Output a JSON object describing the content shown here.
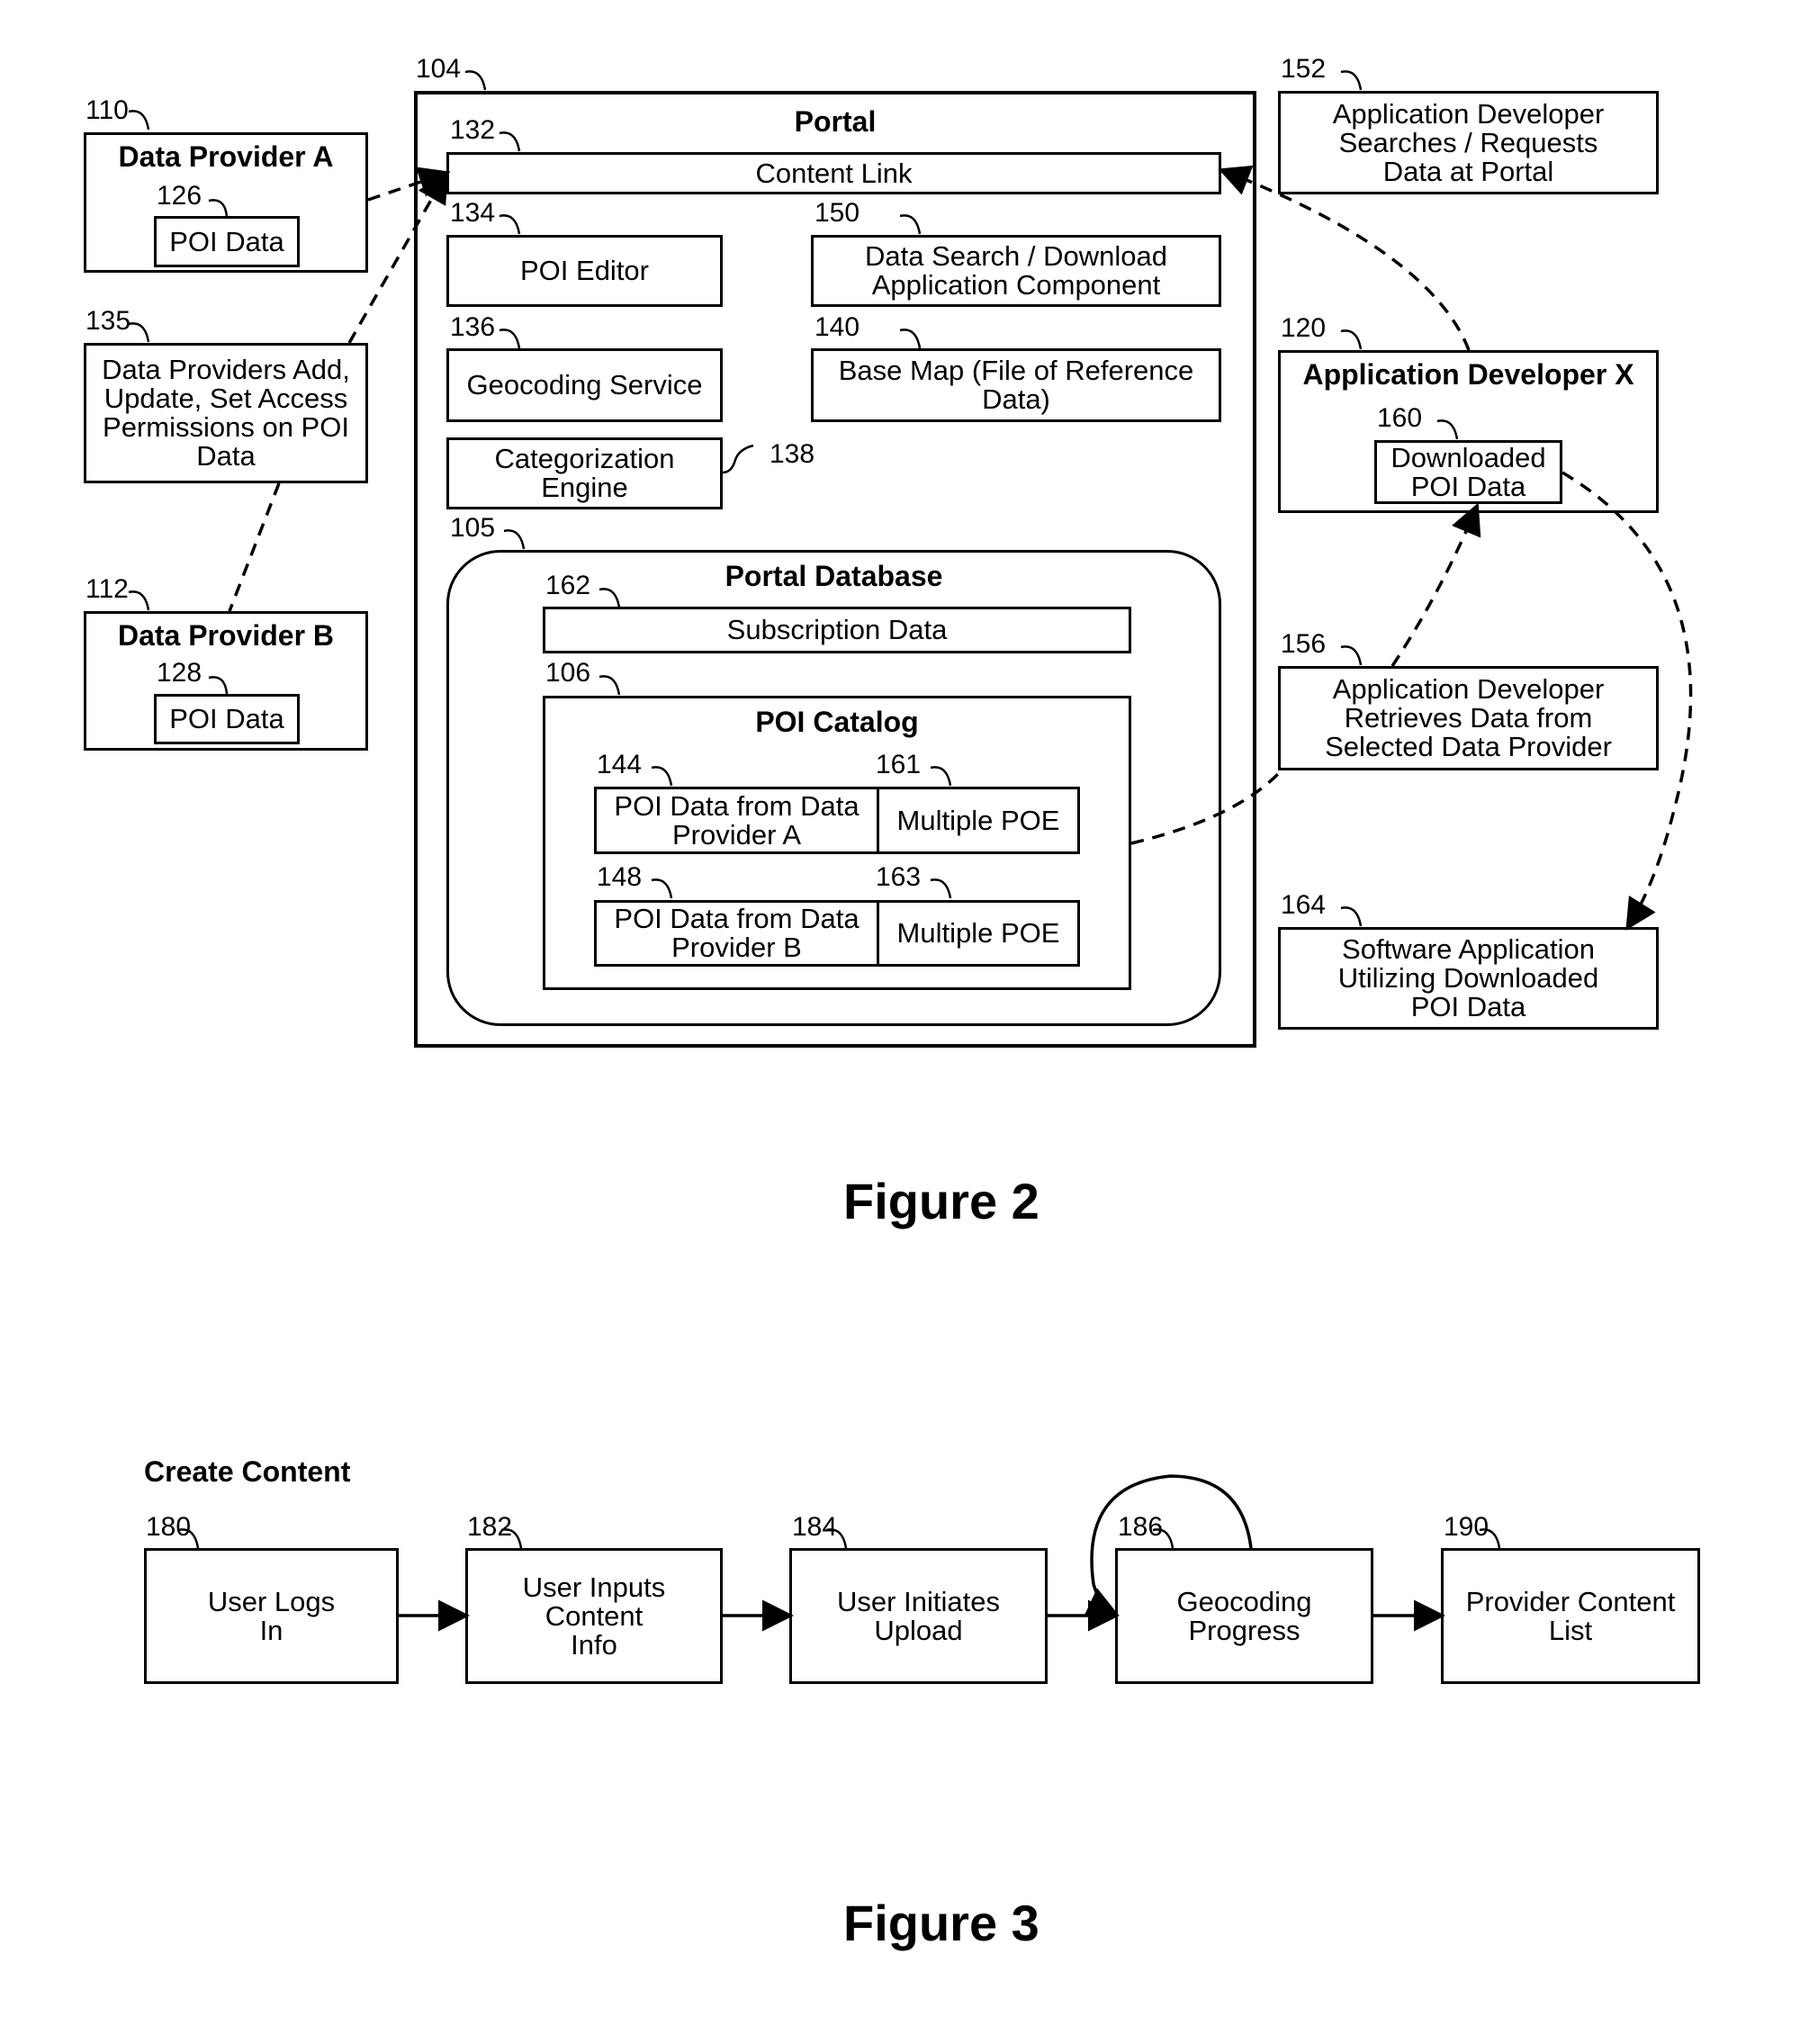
{
  "figure2": {
    "caption": "Figure 2",
    "portal": {
      "ref": "104",
      "title": "Portal"
    },
    "data_provider_a": {
      "ref": "110",
      "title": "Data Provider A",
      "poi": {
        "ref": "126",
        "label": "POI Data"
      }
    },
    "data_provider_b": {
      "ref": "112",
      "title": "Data Provider B",
      "poi": {
        "ref": "128",
        "label": "POI Data"
      }
    },
    "provider_actions": {
      "ref": "135",
      "label": "Data Providers Add,\nUpdate, Set Access\nPermissions on POI\nData"
    },
    "content_link": {
      "ref": "132",
      "label": "Content Link"
    },
    "poi_editor": {
      "ref": "134",
      "label": "POI Editor"
    },
    "data_search": {
      "ref": "150",
      "label": "Data Search / Download\nApplication Component"
    },
    "geocoding_service": {
      "ref": "136",
      "label": "Geocoding Service"
    },
    "base_map": {
      "ref": "140",
      "label": "Base Map (File of Reference\nData)"
    },
    "categorization_engine": {
      "ref": "138",
      "label": "Categorization\nEngine"
    },
    "portal_database": {
      "ref": "105",
      "title": "Portal Database",
      "subscription": {
        "ref": "162",
        "label": "Subscription Data"
      },
      "poi_catalog": {
        "ref": "106",
        "title": "POI Catalog",
        "rows": [
          {
            "data_ref": "144",
            "data_label": "POI Data from Data\nProvider A",
            "poe_ref": "161",
            "poe_label": "Multiple POE"
          },
          {
            "data_ref": "148",
            "data_label": "POI Data from Data\nProvider B",
            "poe_ref": "163",
            "poe_label": "Multiple POE"
          }
        ]
      }
    },
    "dev_search": {
      "ref": "152",
      "label": "Application Developer\nSearches / Requests\nData at Portal"
    },
    "app_developer": {
      "ref": "120",
      "title": "Application Developer X",
      "downloaded": {
        "ref": "160",
        "label": "Downloaded\nPOI Data"
      }
    },
    "dev_retrieves": {
      "ref": "156",
      "label": "Application Developer\nRetrieves Data from\nSelected Data Provider"
    },
    "software_app": {
      "ref": "164",
      "label": "Software Application\nUtilizing Downloaded\nPOI Data"
    }
  },
  "figure3": {
    "caption": "Figure 3",
    "heading": "Create Content",
    "steps": [
      {
        "ref": "180",
        "label": "User Logs\nIn"
      },
      {
        "ref": "182",
        "label": "User Inputs\nContent\nInfo"
      },
      {
        "ref": "184",
        "label": "User Initiates\nUpload"
      },
      {
        "ref": "186",
        "label": "Geocoding\nProgress"
      },
      {
        "ref": "190",
        "label": "Provider Content\nList"
      }
    ]
  }
}
